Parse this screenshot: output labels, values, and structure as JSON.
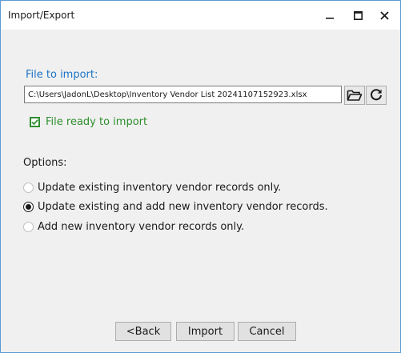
{
  "window": {
    "title": "Import/Export",
    "controls": [
      "minimize-icon",
      "maximize-icon",
      "close-icon"
    ]
  },
  "file": {
    "label": "File to import:",
    "path": "C:\\Users\\JadonL\\Desktop\\Inventory Vendor List 20241107152923.xlsx",
    "browse_icon": "folder-open-icon",
    "refresh_icon": "refresh-icon"
  },
  "status": {
    "text": "File ready to import",
    "checked": true,
    "color": "#2f8f2f"
  },
  "options": {
    "label": "Options:",
    "items": [
      {
        "label": "Update existing inventory vendor records only.",
        "selected": false
      },
      {
        "label": "Update existing and add new inventory vendor records.",
        "selected": true
      },
      {
        "label": "Add new inventory vendor records only.",
        "selected": false
      }
    ]
  },
  "buttons": {
    "back": "<Back",
    "import": "Import",
    "cancel": "Cancel"
  },
  "colors": {
    "accent": "#1b74c7",
    "window_border": "#5b9bd5",
    "content_bg": "#f0f0f0"
  }
}
